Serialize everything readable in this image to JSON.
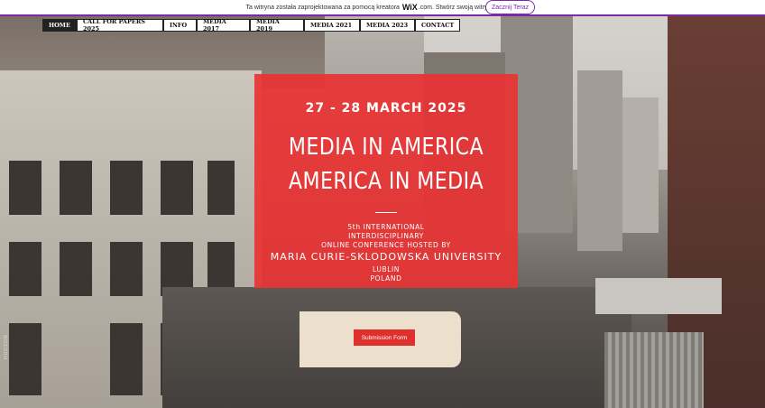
{
  "wix_banner": {
    "text_before": "Ta witryna została zaprojektowana za pomocą kreatora",
    "brand": "WiX",
    "text_after": ".com. Stwórz swoją witrynę już dziś.",
    "cta_label": "Zacznij Teraz"
  },
  "nav": {
    "items": [
      {
        "label": "HOME",
        "active": true
      },
      {
        "label": "CALL FOR PAPERS 2025",
        "active": false
      },
      {
        "label": "INFO",
        "active": false
      },
      {
        "label": "MEDIA 2017",
        "active": false
      },
      {
        "label": "MEDIA 2019",
        "active": false
      },
      {
        "label": "MEDIA 2021",
        "active": false
      },
      {
        "label": "MEDIA 2023",
        "active": false
      },
      {
        "label": "CONTACT",
        "active": false
      }
    ]
  },
  "hero": {
    "date": "27 - 28 MARCH 2025",
    "title_line1": "MEDIA IN AMERICA",
    "title_line2": "AMERICA IN MEDIA",
    "line1": "5th INTERNATIONAL",
    "line2": "INTERDISCIPLINARY",
    "line3": "ONLINE CONFERENCE HOSTED BY",
    "university": "MARIA CURIE-SKLODOWSKA UNIVERSITY",
    "city": "LUBLIN",
    "country": "POLAND"
  },
  "submission": {
    "button_label": "Submission Form"
  },
  "background": {
    "sign_text": "HUDSON"
  },
  "colors": {
    "accent_red": "#e83333",
    "card_beige": "#ecdfcc",
    "wix_purple": "#7a2aa8"
  }
}
